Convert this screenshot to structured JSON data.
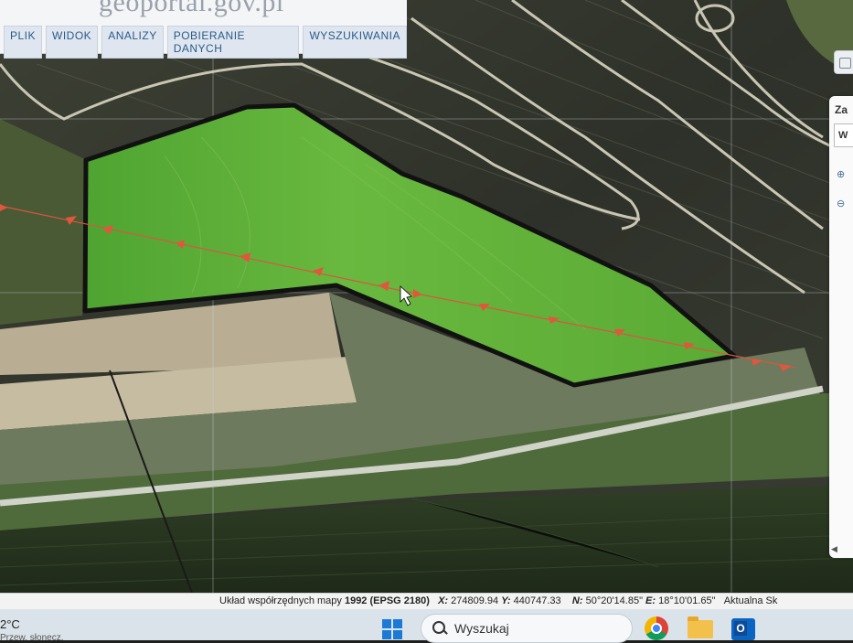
{
  "app": {
    "logo_text": "geoportal.gov.pl"
  },
  "menu": {
    "items": [
      {
        "label": "PLIK"
      },
      {
        "label": "WIDOK"
      },
      {
        "label": "ANALIZY"
      },
      {
        "label": "POBIERANIE DANYCH"
      },
      {
        "label": "WYSZUKIWANIA"
      }
    ]
  },
  "right_panel": {
    "title": "Za",
    "box_label": "W",
    "scroll_label": "◀"
  },
  "statusbar": {
    "system_label": "Układ współrzędnych mapy",
    "system_value": "1992 (EPSG 2180)",
    "x_label": "X:",
    "x_value": "274809.94",
    "y_label": "Y:",
    "y_value": "440747.33",
    "n_label": "N:",
    "n_value": "50°20'14.85\"",
    "e_label": "E:",
    "e_value": "18°10'01.65\"",
    "extra": "Aktualna Sk"
  },
  "taskbar": {
    "weather_temp": "2°C",
    "weather_sub": "Przew. słonecz.",
    "search_placeholder": "Wyszukaj"
  },
  "colors": {
    "parcel_fill": "#5fb03a",
    "parcel_outline": "#111111",
    "route_line": "#d9573f",
    "menu_text": "#2a5b8a"
  }
}
